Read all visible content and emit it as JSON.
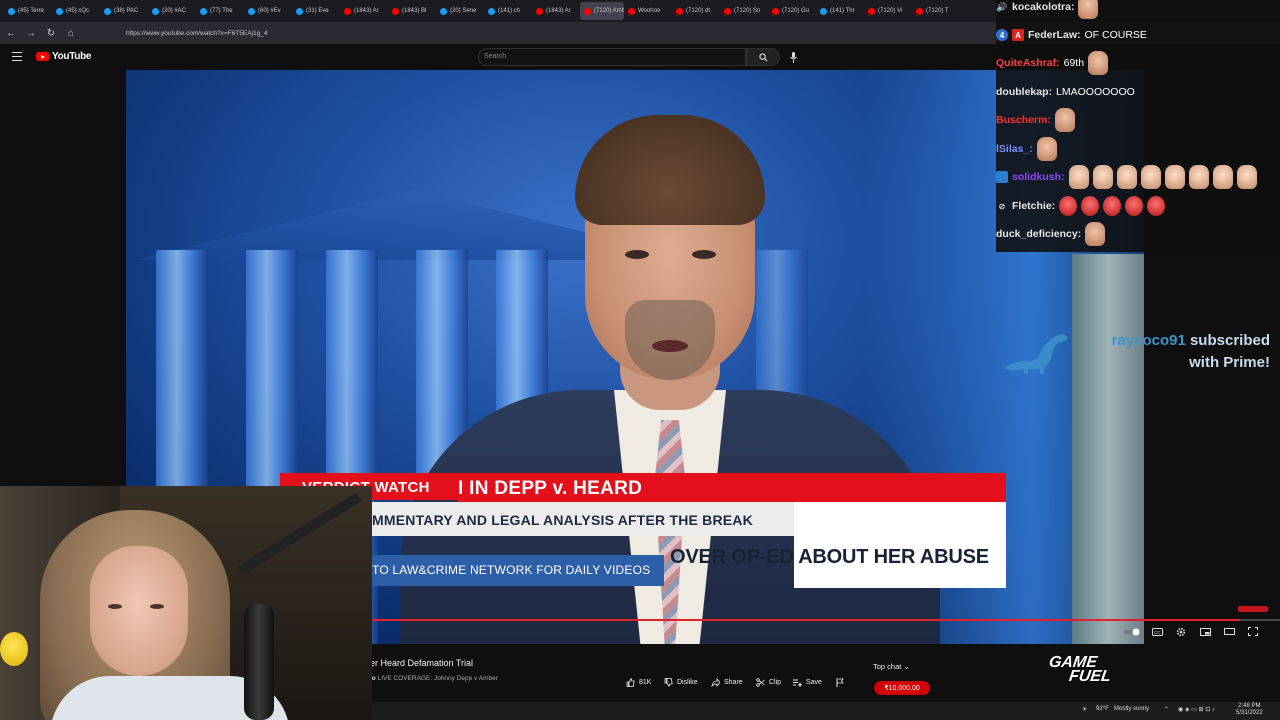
{
  "browser": {
    "tabs": [
      {
        "label": "(45) Terre",
        "color": "#1d9bf0"
      },
      {
        "label": "(45) xQc",
        "color": "#1d9bf0"
      },
      {
        "label": "(38) PAC",
        "color": "#1d9bf0"
      },
      {
        "label": "(20) #AC",
        "color": "#1d9bf0"
      },
      {
        "label": "(77) The",
        "color": "#1d9bf0"
      },
      {
        "label": "(60) #Ev",
        "color": "#1d9bf0"
      },
      {
        "label": "(31) Eve",
        "color": "#1d9bf0"
      },
      {
        "label": "(1843) Ar",
        "color": "#ff0000"
      },
      {
        "label": "(1843) Bl",
        "color": "#ff0000"
      },
      {
        "label": "(20) Sene",
        "color": "#1d9bf0"
      },
      {
        "label": "(141) ch",
        "color": "#1d9bf0"
      },
      {
        "label": "(1843) Ar",
        "color": "#ff0000"
      },
      {
        "label": "(7120) Amber",
        "color": "#ff0000",
        "active": true
      },
      {
        "label": "Woohoo",
        "color": "#ff0000"
      },
      {
        "label": "(7120) dt",
        "color": "#ff0000"
      },
      {
        "label": "(7120) Sn",
        "color": "#ff0000"
      },
      {
        "label": "(7120) Gu",
        "color": "#ff0000"
      },
      {
        "label": "(141) Thr",
        "color": "#1d9bf0"
      },
      {
        "label": "(7120) Vi",
        "color": "#ff0000"
      },
      {
        "label": "(7120) T",
        "color": "#ff0000"
      }
    ],
    "url": "https://www.youtube.com/watch?v=F6T5EAj1g_4"
  },
  "youtube": {
    "logo_text": "YouTube",
    "search_placeholder": "Search"
  },
  "video": {
    "banner_label": "VERDICT WATCH",
    "headline": "I IN DEPP v. HEARD",
    "subline1": "MMENTARY AND LEGAL ANALYSIS AFTER THE BREAK",
    "subline2": "OVER OP-ED ABOUT HER ABUSE",
    "ticker": "TO LAW&CRIME NETWORK FOR DAILY VIDEOS",
    "progress": 0.956
  },
  "below_video": {
    "title": "er Heard Defamation Trial",
    "channel_prefix": "jo",
    "description": "LIVE COVERAGE: Johnny Depp v Amber",
    "actions": {
      "like_count": "81K",
      "dislike_label": "Dislike",
      "share_label": "Share",
      "clip_label": "Clip",
      "save_label": "Save"
    },
    "top_chat_label": "Top chat",
    "super_chat_amount": "₹10,000.00"
  },
  "sponsor": {
    "line1": "GAME",
    "line2": "FUEL"
  },
  "chat": [
    {
      "user": "kocakolotra:",
      "color": "#e5e5e5",
      "msg": "",
      "emotes": [
        "face1"
      ]
    },
    {
      "user": "FederLaw:",
      "color": "#e5e5e5",
      "msg": "OF COURSE",
      "emotes": [],
      "badges": [
        "4",
        "A"
      ]
    },
    {
      "user": "QuiteAshraf:",
      "color": "#ff4040",
      "msg": "69th",
      "emotes": [
        "face1"
      ]
    },
    {
      "user": "doublekap:",
      "color": "#e5e5e5",
      "msg": "LMAOOOOOOO",
      "emotes": []
    },
    {
      "user": "Buscherm:",
      "color": "#ff3030",
      "msg": "",
      "emotes": [
        "face1"
      ]
    },
    {
      "user": "lSilas_:",
      "color": "#7a8cff",
      "msg": "",
      "emotes": [
        "face1"
      ]
    },
    {
      "user": "solidkush:",
      "color": "#9146ff",
      "msg": "",
      "emotes": [
        "clown",
        "clown",
        "clown",
        "clown",
        "clown",
        "clown",
        "clown",
        "clown"
      ]
    },
    {
      "user": "Fletchie:",
      "color": "#e5e5e5",
      "msg": "",
      "emotes": [
        "red",
        "red",
        "red",
        "red",
        "red"
      ]
    },
    {
      "user": "duck_deficiency:",
      "color": "#e5e5e5",
      "msg": "",
      "emotes": [
        "face1"
      ]
    }
  ],
  "sub_alert": {
    "name": "raycoco91",
    "text1": "subscribed",
    "text2": "with Prime!"
  },
  "taskbar": {
    "weather": "92°F",
    "condition": "Mostly sunny",
    "time": "2:48 PM",
    "date": "5/31/2022"
  }
}
